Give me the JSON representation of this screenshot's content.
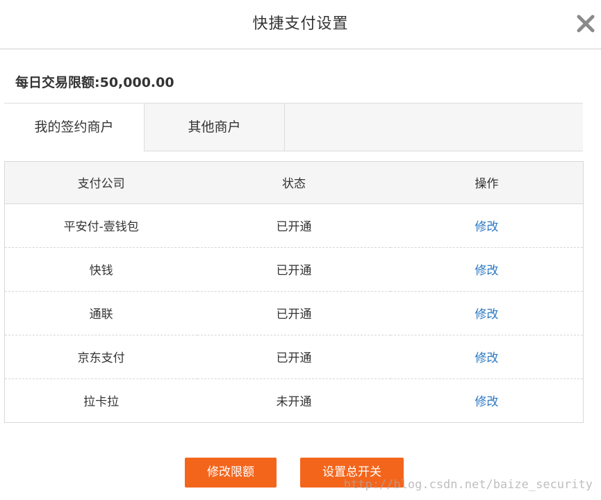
{
  "dialog": {
    "title": "快捷支付设置",
    "close_icon": "close-icon"
  },
  "limit": {
    "text": "每日交易限额:50,000.00"
  },
  "tabs": [
    {
      "label": "我的签约商户",
      "active": true
    },
    {
      "label": "其他商户",
      "active": false
    }
  ],
  "table": {
    "headers": [
      "支付公司",
      "状态",
      "操作"
    ],
    "rows": [
      {
        "company": "平安付-壹钱包",
        "status": "已开通",
        "action": "修改"
      },
      {
        "company": "快钱",
        "status": "已开通",
        "action": "修改"
      },
      {
        "company": "通联",
        "status": "已开通",
        "action": "修改"
      },
      {
        "company": "京东支付",
        "status": "已开通",
        "action": "修改"
      },
      {
        "company": "拉卡拉",
        "status": "未开通",
        "action": "修改"
      }
    ]
  },
  "buttons": {
    "modify_limit": "修改限额",
    "master_switch": "设置总开关"
  },
  "watermark": "http://blog.csdn.net/baize_security",
  "colors": {
    "accent_button": "#f4651c",
    "link": "#2b78c2",
    "header_bg": "#f5f5f5"
  }
}
